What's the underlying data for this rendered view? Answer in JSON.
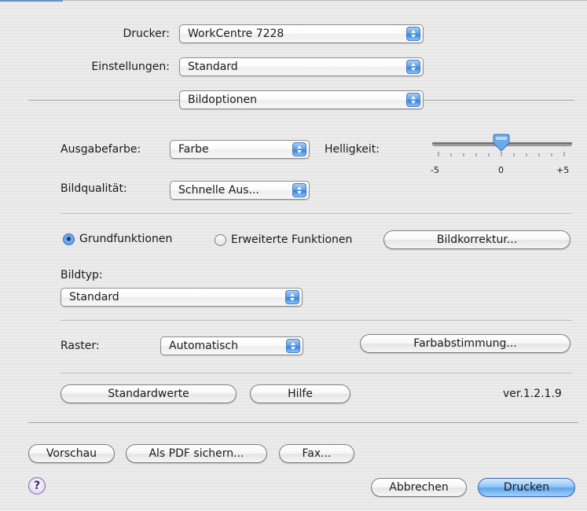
{
  "printer": {
    "label": "Drucker:",
    "value": "WorkCentre 7228"
  },
  "presets": {
    "label": "Einstellungen:",
    "value": "Standard"
  },
  "panel": {
    "value": "Bildoptionen"
  },
  "output_color": {
    "label": "Ausgabefarbe:",
    "value": "Farbe"
  },
  "brightness": {
    "label": "Helligkeit:",
    "min_label": "-5",
    "mid_label": "0",
    "max_label": "+5",
    "value": 0,
    "min": -5,
    "max": 5
  },
  "image_quality": {
    "label": "Bildqualität:",
    "value": "Schnelle Aus..."
  },
  "mode": {
    "basic_label": "Grundfunktionen",
    "advanced_label": "Erweiterte Funktionen",
    "selected": "basic"
  },
  "image_correction_button": "Bildkorrektur...",
  "image_type": {
    "label": "Bildtyp:",
    "value": "Standard"
  },
  "screen": {
    "label": "Raster:",
    "value": "Automatisch"
  },
  "color_matching_button": "Farbabstimmung...",
  "defaults_button": "Standardwerte",
  "help_button": "Hilfe",
  "version": "ver.1.2.1.9",
  "footer": {
    "preview_button": "Vorschau",
    "save_pdf_button": "Als PDF sichern...",
    "fax_button": "Fax...",
    "help_icon_glyph": "?",
    "cancel_button": "Abbrechen",
    "print_button": "Drucken"
  }
}
